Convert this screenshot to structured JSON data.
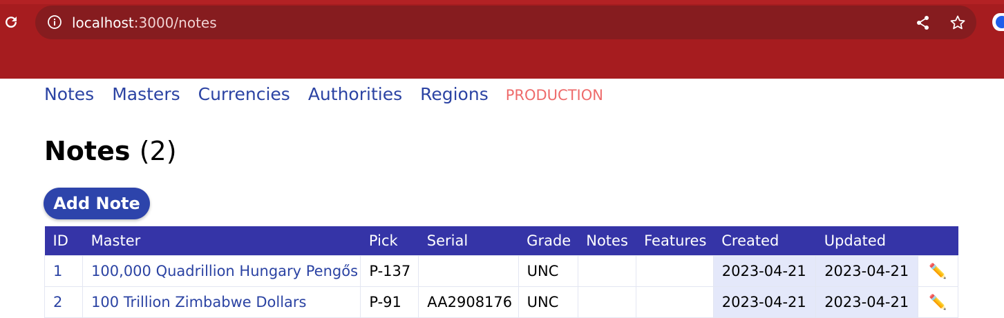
{
  "browser": {
    "url_host": "localhost",
    "url_path": ":3000/notes"
  },
  "nav": {
    "items": [
      "Notes",
      "Masters",
      "Currencies",
      "Authorities",
      "Regions"
    ],
    "environment": "PRODUCTION"
  },
  "page": {
    "title": "Notes",
    "count": "(2)",
    "add_button": "Add Note"
  },
  "table": {
    "headers": [
      "ID",
      "Master",
      "Pick",
      "Serial",
      "Grade",
      "Notes",
      "Features",
      "Created",
      "Updated"
    ],
    "rows": [
      {
        "id": "1",
        "master": "100,000 Quadrillion Hungary Pengős",
        "pick": "P-137",
        "serial": "",
        "grade": "UNC",
        "notes": "",
        "features": "",
        "created": "2023-04-21",
        "updated": "2023-04-21",
        "edit": "✏️"
      },
      {
        "id": "2",
        "master": "100 Trillion Zimbabwe Dollars",
        "pick": "P-91",
        "serial": "AA2908176",
        "grade": "UNC",
        "notes": "",
        "features": "",
        "created": "2023-04-21",
        "updated": "2023-04-21",
        "edit": "✏️"
      }
    ]
  },
  "colors": {
    "chrome": "#a61c1f",
    "omnibox": "#861c1f",
    "header_bg": "#3534a7",
    "link": "#2b43a3",
    "environment": "#ee6b6b",
    "date_cell_bg": "#e4e8fa"
  },
  "icons": [
    "reload-icon",
    "info-icon",
    "share-icon",
    "star-icon",
    "extension-icon",
    "pencil-icon"
  ]
}
